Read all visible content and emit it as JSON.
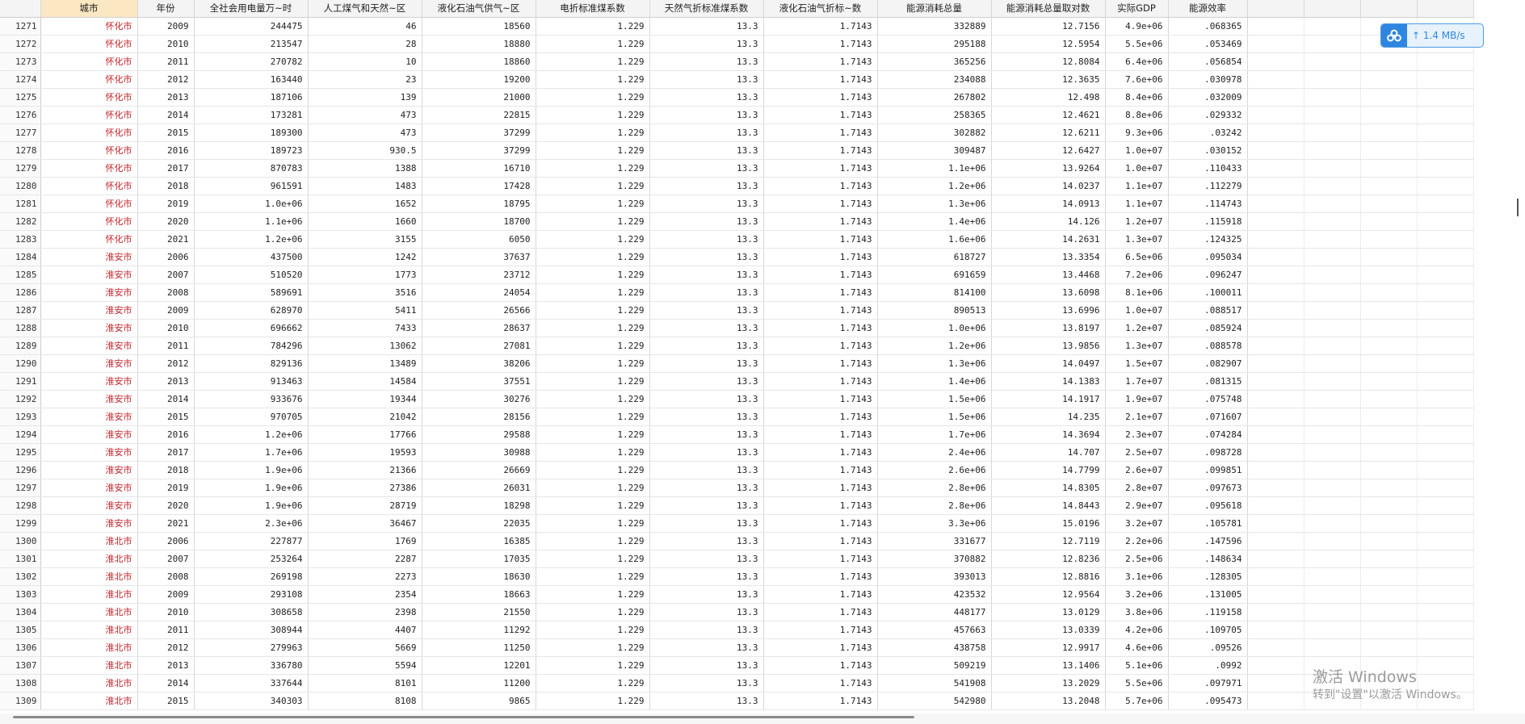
{
  "columns": [
    "城市",
    "年份",
    "全社会用电量万~时",
    "人工煤气和天然~区",
    "液化石油气供气~区",
    "电折标准煤系数",
    "天然气折标准煤系数",
    "液化石油气折标~数",
    "能源消耗总量",
    "能源消耗总量取对数",
    "实际GDP",
    "能源效率"
  ],
  "empty_columns": 4,
  "rows": [
    [
      "1271",
      "怀化市",
      "2009",
      "244475",
      "46",
      "18560",
      "1.229",
      "13.3",
      "1.7143",
      "332889",
      "12.7156",
      "4.9e+06",
      ".068365"
    ],
    [
      "1272",
      "怀化市",
      "2010",
      "213547",
      "28",
      "18880",
      "1.229",
      "13.3",
      "1.7143",
      "295188",
      "12.5954",
      "5.5e+06",
      ".053469"
    ],
    [
      "1273",
      "怀化市",
      "2011",
      "270782",
      "10",
      "18860",
      "1.229",
      "13.3",
      "1.7143",
      "365256",
      "12.8084",
      "6.4e+06",
      ".056854"
    ],
    [
      "1274",
      "怀化市",
      "2012",
      "163440",
      "23",
      "19200",
      "1.229",
      "13.3",
      "1.7143",
      "234088",
      "12.3635",
      "7.6e+06",
      ".030978"
    ],
    [
      "1275",
      "怀化市",
      "2013",
      "187106",
      "139",
      "21000",
      "1.229",
      "13.3",
      "1.7143",
      "267802",
      "12.498",
      "8.4e+06",
      ".032009"
    ],
    [
      "1276",
      "怀化市",
      "2014",
      "173281",
      "473",
      "22815",
      "1.229",
      "13.3",
      "1.7143",
      "258365",
      "12.4621",
      "8.8e+06",
      ".029332"
    ],
    [
      "1277",
      "怀化市",
      "2015",
      "189300",
      "473",
      "37299",
      "1.229",
      "13.3",
      "1.7143",
      "302882",
      "12.6211",
      "9.3e+06",
      ".03242"
    ],
    [
      "1278",
      "怀化市",
      "2016",
      "189723",
      "930.5",
      "37299",
      "1.229",
      "13.3",
      "1.7143",
      "309487",
      "12.6427",
      "1.0e+07",
      ".030152"
    ],
    [
      "1279",
      "怀化市",
      "2017",
      "870783",
      "1388",
      "16710",
      "1.229",
      "13.3",
      "1.7143",
      "1.1e+06",
      "13.9264",
      "1.0e+07",
      ".110433"
    ],
    [
      "1280",
      "怀化市",
      "2018",
      "961591",
      "1483",
      "17428",
      "1.229",
      "13.3",
      "1.7143",
      "1.2e+06",
      "14.0237",
      "1.1e+07",
      ".112279"
    ],
    [
      "1281",
      "怀化市",
      "2019",
      "1.0e+06",
      "1652",
      "18795",
      "1.229",
      "13.3",
      "1.7143",
      "1.3e+06",
      "14.0913",
      "1.1e+07",
      ".114743"
    ],
    [
      "1282",
      "怀化市",
      "2020",
      "1.1e+06",
      "1660",
      "18700",
      "1.229",
      "13.3",
      "1.7143",
      "1.4e+06",
      "14.126",
      "1.2e+07",
      ".115918"
    ],
    [
      "1283",
      "怀化市",
      "2021",
      "1.2e+06",
      "3155",
      "6050",
      "1.229",
      "13.3",
      "1.7143",
      "1.6e+06",
      "14.2631",
      "1.3e+07",
      ".124325"
    ],
    [
      "1284",
      "淮安市",
      "2006",
      "437500",
      "1242",
      "37637",
      "1.229",
      "13.3",
      "1.7143",
      "618727",
      "13.3354",
      "6.5e+06",
      ".095034"
    ],
    [
      "1285",
      "淮安市",
      "2007",
      "510520",
      "1773",
      "23712",
      "1.229",
      "13.3",
      "1.7143",
      "691659",
      "13.4468",
      "7.2e+06",
      ".096247"
    ],
    [
      "1286",
      "淮安市",
      "2008",
      "589691",
      "3516",
      "24054",
      "1.229",
      "13.3",
      "1.7143",
      "814100",
      "13.6098",
      "8.1e+06",
      ".100011"
    ],
    [
      "1287",
      "淮安市",
      "2009",
      "628970",
      "5411",
      "26566",
      "1.229",
      "13.3",
      "1.7143",
      "890513",
      "13.6996",
      "1.0e+07",
      ".088517"
    ],
    [
      "1288",
      "淮安市",
      "2010",
      "696662",
      "7433",
      "28637",
      "1.229",
      "13.3",
      "1.7143",
      "1.0e+06",
      "13.8197",
      "1.2e+07",
      ".085924"
    ],
    [
      "1289",
      "淮安市",
      "2011",
      "784296",
      "13062",
      "27081",
      "1.229",
      "13.3",
      "1.7143",
      "1.2e+06",
      "13.9856",
      "1.3e+07",
      ".088578"
    ],
    [
      "1290",
      "淮安市",
      "2012",
      "829136",
      "13489",
      "38206",
      "1.229",
      "13.3",
      "1.7143",
      "1.3e+06",
      "14.0497",
      "1.5e+07",
      ".082907"
    ],
    [
      "1291",
      "淮安市",
      "2013",
      "913463",
      "14584",
      "37551",
      "1.229",
      "13.3",
      "1.7143",
      "1.4e+06",
      "14.1383",
      "1.7e+07",
      ".081315"
    ],
    [
      "1292",
      "淮安市",
      "2014",
      "933676",
      "19344",
      "30276",
      "1.229",
      "13.3",
      "1.7143",
      "1.5e+06",
      "14.1917",
      "1.9e+07",
      ".075748"
    ],
    [
      "1293",
      "淮安市",
      "2015",
      "970705",
      "21042",
      "28156",
      "1.229",
      "13.3",
      "1.7143",
      "1.5e+06",
      "14.235",
      "2.1e+07",
      ".071607"
    ],
    [
      "1294",
      "淮安市",
      "2016",
      "1.2e+06",
      "17766",
      "29588",
      "1.229",
      "13.3",
      "1.7143",
      "1.7e+06",
      "14.3694",
      "2.3e+07",
      ".074284"
    ],
    [
      "1295",
      "淮安市",
      "2017",
      "1.7e+06",
      "19593",
      "30988",
      "1.229",
      "13.3",
      "1.7143",
      "2.4e+06",
      "14.707",
      "2.5e+07",
      ".098728"
    ],
    [
      "1296",
      "淮安市",
      "2018",
      "1.9e+06",
      "21366",
      "26669",
      "1.229",
      "13.3",
      "1.7143",
      "2.6e+06",
      "14.7799",
      "2.6e+07",
      ".099851"
    ],
    [
      "1297",
      "淮安市",
      "2019",
      "1.9e+06",
      "27386",
      "26031",
      "1.229",
      "13.3",
      "1.7143",
      "2.8e+06",
      "14.8305",
      "2.8e+07",
      ".097673"
    ],
    [
      "1298",
      "淮安市",
      "2020",
      "1.9e+06",
      "28719",
      "18298",
      "1.229",
      "13.3",
      "1.7143",
      "2.8e+06",
      "14.8443",
      "2.9e+07",
      ".095618"
    ],
    [
      "1299",
      "淮安市",
      "2021",
      "2.3e+06",
      "36467",
      "22035",
      "1.229",
      "13.3",
      "1.7143",
      "3.3e+06",
      "15.0196",
      "3.2e+07",
      ".105781"
    ],
    [
      "1300",
      "淮北市",
      "2006",
      "227877",
      "1769",
      "16385",
      "1.229",
      "13.3",
      "1.7143",
      "331677",
      "12.7119",
      "2.2e+06",
      ".147596"
    ],
    [
      "1301",
      "淮北市",
      "2007",
      "253264",
      "2287",
      "17035",
      "1.229",
      "13.3",
      "1.7143",
      "370882",
      "12.8236",
      "2.5e+06",
      ".148634"
    ],
    [
      "1302",
      "淮北市",
      "2008",
      "269198",
      "2273",
      "18630",
      "1.229",
      "13.3",
      "1.7143",
      "393013",
      "12.8816",
      "3.1e+06",
      ".128305"
    ],
    [
      "1303",
      "淮北市",
      "2009",
      "293108",
      "2354",
      "18663",
      "1.229",
      "13.3",
      "1.7143",
      "423532",
      "12.9564",
      "3.2e+06",
      ".131005"
    ],
    [
      "1304",
      "淮北市",
      "2010",
      "308658",
      "2398",
      "21550",
      "1.229",
      "13.3",
      "1.7143",
      "448177",
      "13.0129",
      "3.8e+06",
      ".119158"
    ],
    [
      "1305",
      "淮北市",
      "2011",
      "308944",
      "4407",
      "11292",
      "1.229",
      "13.3",
      "1.7143",
      "457663",
      "13.0339",
      "4.2e+06",
      ".109705"
    ],
    [
      "1306",
      "淮北市",
      "2012",
      "279963",
      "5669",
      "11250",
      "1.229",
      "13.3",
      "1.7143",
      "438758",
      "12.9917",
      "4.6e+06",
      ".09526"
    ],
    [
      "1307",
      "淮北市",
      "2013",
      "336780",
      "5594",
      "12201",
      "1.229",
      "13.3",
      "1.7143",
      "509219",
      "13.1406",
      "5.1e+06",
      ".0992"
    ],
    [
      "1308",
      "淮北市",
      "2014",
      "337644",
      "8101",
      "11200",
      "1.229",
      "13.3",
      "1.7143",
      "541908",
      "13.2029",
      "5.5e+06",
      ".097971"
    ],
    [
      "1309",
      "淮北市",
      "2015",
      "340303",
      "8108",
      "9865",
      "1.229",
      "13.3",
      "1.7143",
      "542980",
      "13.2048",
      "5.7e+06",
      ".095473"
    ]
  ],
  "speed_widget": {
    "text": "↑ 1.4 MB/s",
    "icon": "cloud-icon"
  },
  "watermark": {
    "title": "激活 Windows",
    "subtitle": "转到\"设置\"以激活 Windows。"
  }
}
